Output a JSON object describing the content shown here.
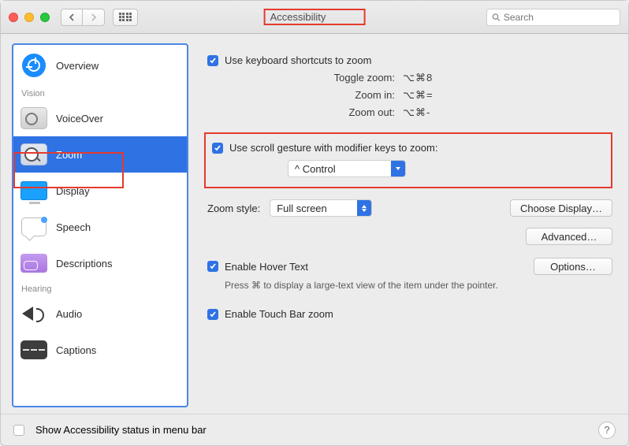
{
  "window": {
    "title": "Accessibility",
    "search_placeholder": "Search"
  },
  "sidebar": {
    "sections": {
      "vision": "Vision",
      "hearing": "Hearing"
    },
    "items": {
      "overview": "Overview",
      "voiceover": "VoiceOver",
      "zoom": "Zoom",
      "display": "Display",
      "speech": "Speech",
      "descriptions": "Descriptions",
      "audio": "Audio",
      "captions": "Captions"
    },
    "selected": "zoom"
  },
  "zoom_pane": {
    "use_shortcuts": {
      "label": "Use keyboard shortcuts to zoom",
      "checked": true
    },
    "shortcuts": {
      "toggle": {
        "label": "Toggle zoom:",
        "value": "⌥⌘8"
      },
      "zoom_in": {
        "label": "Zoom in:",
        "value": "⌥⌘="
      },
      "zoom_out": {
        "label": "Zoom out:",
        "value": "⌥⌘-"
      }
    },
    "scroll_gesture": {
      "label": "Use scroll gesture with modifier keys to zoom:",
      "checked": true,
      "modifier": "^ Control"
    },
    "zoom_style": {
      "label": "Zoom style:",
      "value": "Full screen"
    },
    "choose_display": "Choose Display…",
    "advanced": "Advanced…",
    "hover_text": {
      "label": "Enable Hover Text",
      "checked": true,
      "options": "Options…"
    },
    "hover_hint": "Press ⌘ to display a large-text view of the item under the pointer.",
    "touch_bar": {
      "label": "Enable Touch Bar zoom",
      "checked": true
    }
  },
  "footer": {
    "status_label": "Show Accessibility status in menu bar",
    "status_checked": false,
    "help": "?"
  }
}
